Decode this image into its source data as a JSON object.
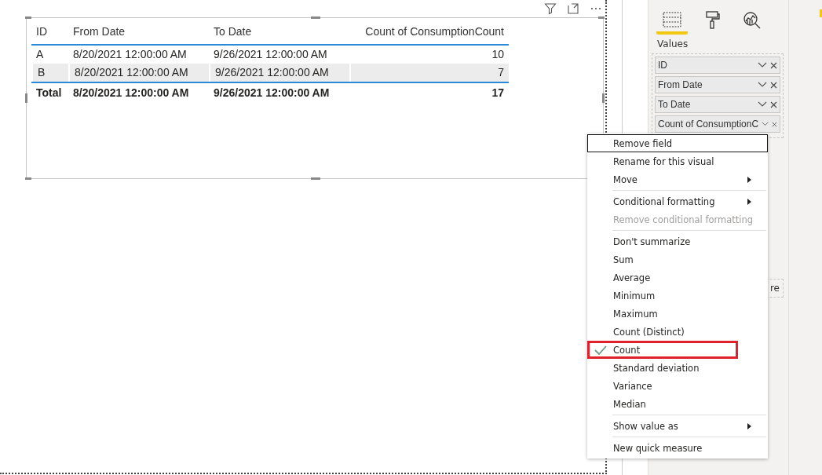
{
  "table": {
    "columns": [
      {
        "label": "ID",
        "kind": "text"
      },
      {
        "label": "From Date",
        "kind": "text"
      },
      {
        "label": "To Date",
        "kind": "text"
      },
      {
        "label": "Count of ConsumptionCount",
        "kind": "number"
      }
    ],
    "rows": [
      {
        "cells": [
          "A",
          "8/20/2021 12:00:00 AM",
          "9/26/2021 12:00:00 AM",
          "10"
        ],
        "highlighted": false
      },
      {
        "cells": [
          "B",
          "8/20/2021 12:00:00 AM",
          "9/26/2021 12:00:00 AM",
          "7"
        ],
        "highlighted": true
      }
    ],
    "total": [
      "Total",
      "8/20/2021 12:00:00 AM",
      "9/26/2021 12:00:00 AM",
      "17"
    ]
  },
  "pane": {
    "tabs": [
      {
        "kind": "fields",
        "selected": true
      },
      {
        "kind": "format",
        "selected": false
      },
      {
        "kind": "analytics",
        "selected": false
      }
    ],
    "section_label": "Values",
    "fields": [
      {
        "label": "ID"
      },
      {
        "label": "From Date"
      },
      {
        "label": "To Date"
      },
      {
        "label": "Count of ConsumptionC"
      }
    ],
    "partial_well_text": "re"
  },
  "context_menu": {
    "items": [
      {
        "kind": "item",
        "label": "Remove field",
        "focused": true,
        "disabled": false,
        "checked": false,
        "submenu": false,
        "annotated": false
      },
      {
        "kind": "item",
        "label": "Rename for this visual",
        "focused": false,
        "disabled": false,
        "checked": false,
        "submenu": false,
        "annotated": false
      },
      {
        "kind": "item",
        "label": "Move",
        "focused": false,
        "disabled": false,
        "checked": false,
        "submenu": true,
        "annotated": false
      },
      {
        "kind": "separator"
      },
      {
        "kind": "item",
        "label": "Conditional formatting",
        "focused": false,
        "disabled": false,
        "checked": false,
        "submenu": true,
        "annotated": false
      },
      {
        "kind": "item",
        "label": "Remove conditional formatting",
        "focused": false,
        "disabled": true,
        "checked": false,
        "submenu": false,
        "annotated": false
      },
      {
        "kind": "separator"
      },
      {
        "kind": "item",
        "label": "Don't summarize",
        "focused": false,
        "disabled": false,
        "checked": false,
        "submenu": false,
        "annotated": false
      },
      {
        "kind": "item",
        "label": "Sum",
        "focused": false,
        "disabled": false,
        "checked": false,
        "submenu": false,
        "annotated": false
      },
      {
        "kind": "item",
        "label": "Average",
        "focused": false,
        "disabled": false,
        "checked": false,
        "submenu": false,
        "annotated": false
      },
      {
        "kind": "item",
        "label": "Minimum",
        "focused": false,
        "disabled": false,
        "checked": false,
        "submenu": false,
        "annotated": false
      },
      {
        "kind": "item",
        "label": "Maximum",
        "focused": false,
        "disabled": false,
        "checked": false,
        "submenu": false,
        "annotated": false
      },
      {
        "kind": "item",
        "label": "Count (Distinct)",
        "focused": false,
        "disabled": false,
        "checked": false,
        "submenu": false,
        "annotated": false
      },
      {
        "kind": "item",
        "label": "Count",
        "focused": false,
        "disabled": false,
        "checked": true,
        "submenu": false,
        "annotated": true
      },
      {
        "kind": "item",
        "label": "Standard deviation",
        "focused": false,
        "disabled": false,
        "checked": false,
        "submenu": false,
        "annotated": false
      },
      {
        "kind": "item",
        "label": "Variance",
        "focused": false,
        "disabled": false,
        "checked": false,
        "submenu": false,
        "annotated": false
      },
      {
        "kind": "item",
        "label": "Median",
        "focused": false,
        "disabled": false,
        "checked": false,
        "submenu": false,
        "annotated": false
      },
      {
        "kind": "separator"
      },
      {
        "kind": "item",
        "label": "Show value as",
        "focused": false,
        "disabled": false,
        "checked": false,
        "submenu": true,
        "annotated": false
      },
      {
        "kind": "separator"
      },
      {
        "kind": "item",
        "label": "New quick measure",
        "focused": false,
        "disabled": false,
        "checked": false,
        "submenu": false,
        "annotated": false
      }
    ]
  }
}
